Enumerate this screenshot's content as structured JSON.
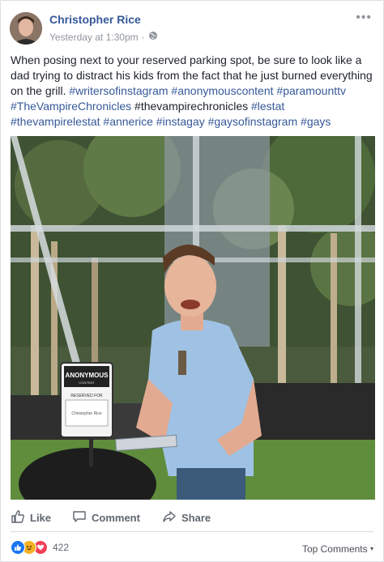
{
  "post": {
    "author": "Christopher Rice",
    "timestamp": "Yesterday at 1:30pm",
    "separator": "·",
    "more_label": "•••",
    "text_plain_1": "When posing next to your reserved parking spot, be sure to look like a dad trying to distract his kids from the fact that he just burned everything on the grill.",
    "tags": {
      "t1": "#writersofinstagram",
      "t2": "#anonymouscontent",
      "t3": "#paramounttv",
      "t4": "#TheVampireChronicles",
      "t6": "#lestat",
      "t7": "#thevampirelestat",
      "t8": "#annerice",
      "t9": "#instagay",
      "t10": "#gaysofinstagram",
      "t11": "#gays"
    },
    "plain_tag": "#thevampirechronicles"
  },
  "photo": {
    "sign_brand": "ANONYMOUS",
    "sign_sub": "CONTENT",
    "sign_reserved": "RESERVED FOR",
    "sign_name": "Christopher Rice"
  },
  "actions": {
    "like": "Like",
    "comment": "Comment",
    "share": "Share"
  },
  "footer": {
    "reaction_count": "422",
    "top_comments": "Top Comments",
    "reaction_icons": [
      "like-icon",
      "haha-icon",
      "love-icon"
    ]
  },
  "colors": {
    "link": "#365899",
    "like_blue": "#1877f2",
    "haha_yellow": "#f7b125",
    "love_red": "#f33e58"
  }
}
